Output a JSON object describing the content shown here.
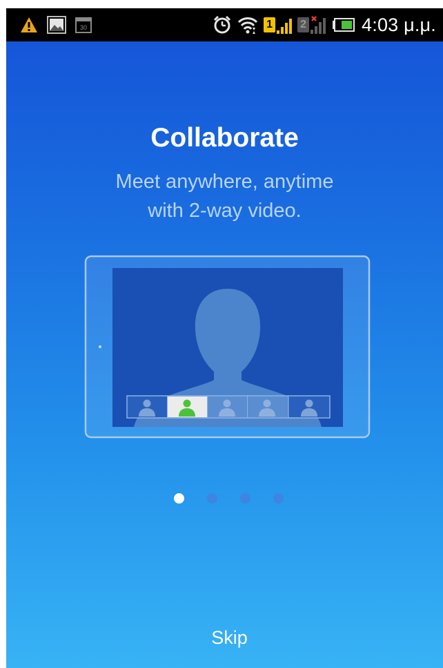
{
  "status_bar": {
    "icons": [
      "warning-icon",
      "image-notification-icon",
      "calendar-icon",
      "alarm-clock-icon",
      "wifi-icon",
      "sim1-signal-icon",
      "sim2-no-signal-icon",
      "battery-icon"
    ],
    "sim1_label": "1",
    "sim2_label": "2",
    "calendar_label": "30",
    "time": "4:03 μ.μ."
  },
  "onboarding": {
    "title": "Collaborate",
    "subtitle_line1": "Meet anywhere, anytime",
    "subtitle_line2": "with 2-way video.",
    "illustration": "tablet-video-call-illustration",
    "highlight_color": "#4cc23a",
    "page_indicator": {
      "total": 4,
      "current": 1
    },
    "skip_label": "Skip"
  }
}
